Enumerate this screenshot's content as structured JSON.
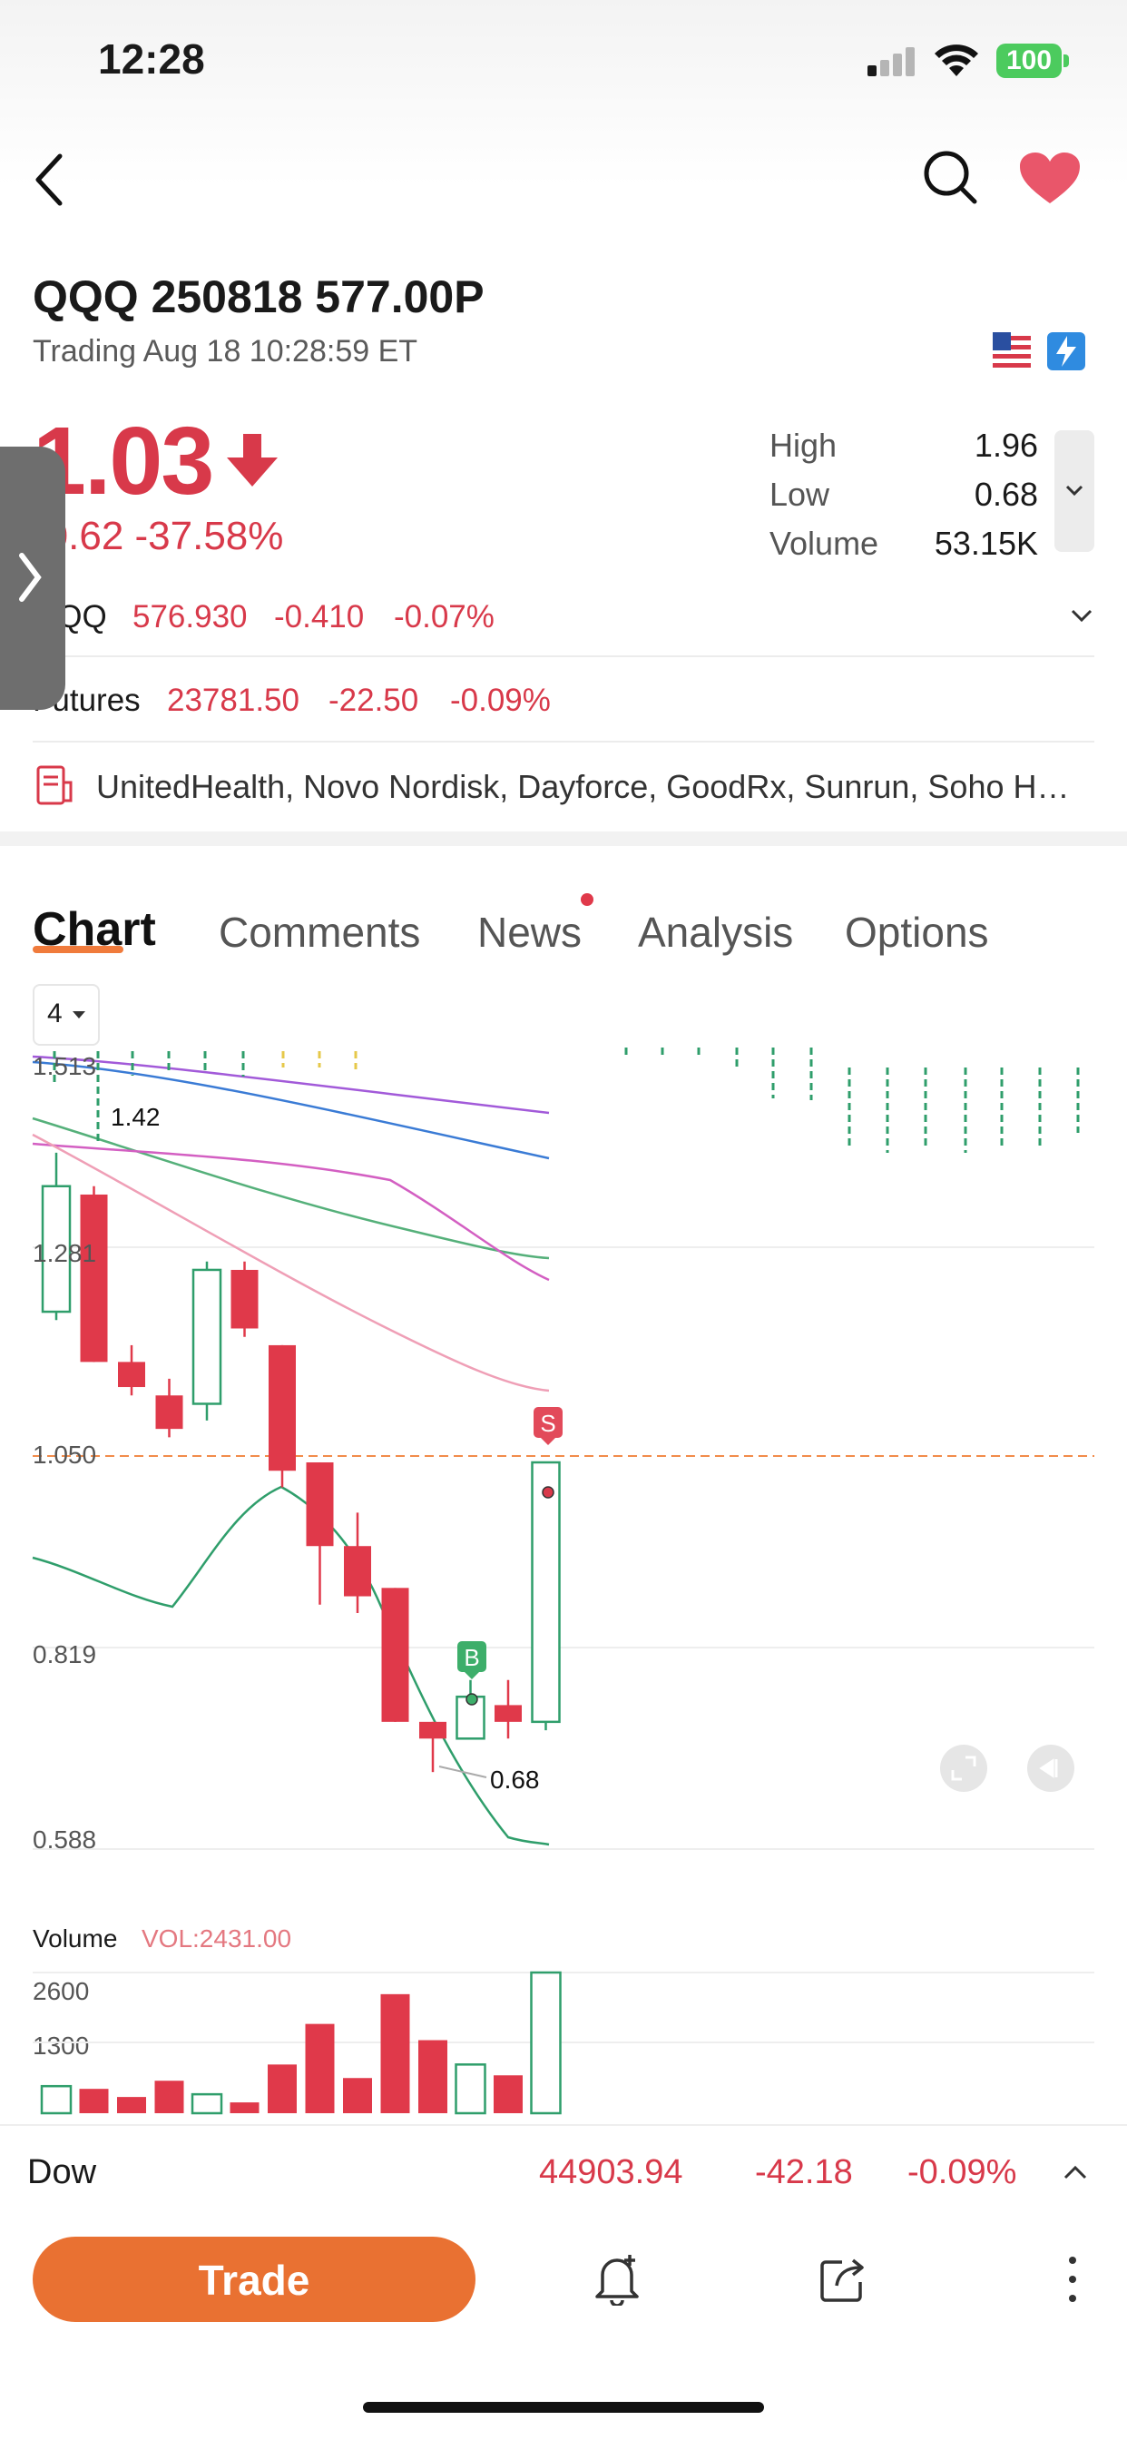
{
  "status_bar": {
    "time": "12:28",
    "battery": "100"
  },
  "header": {
    "back": "back",
    "search": "search",
    "favorite": "favorite"
  },
  "quote": {
    "symbol": "QQQ 250818 577.00P",
    "trading_status": "Trading Aug 18 10:28:59 ET",
    "price": "1.03",
    "change": "-0.62 -37.58%",
    "stats": [
      {
        "label": "High",
        "value": "1.96"
      },
      {
        "label": "Low",
        "value": "0.68"
      },
      {
        "label": "Volume",
        "value": "53.15K"
      }
    ]
  },
  "underlying": {
    "name": "QQQ",
    "price": "576.930",
    "change": "-0.410",
    "pct": "-0.07%"
  },
  "futures": {
    "name": "Futures",
    "price": "23781.50",
    "change": "-22.50",
    "pct": "-0.09%"
  },
  "news_ticker": "UnitedHealth, Novo Nordisk, Dayforce, GoodRx, Sunrun, Soho H…",
  "tabs": [
    "Chart",
    "Comments",
    "News",
    "Analysis",
    "Options"
  ],
  "chart": {
    "interval_label": "4",
    "y_ticks": [
      "1.513",
      "1.281",
      "1.050",
      "0.819",
      "0.588"
    ],
    "high_label": "1.42",
    "low_label": "0.68",
    "sell_marker": "S",
    "buy_marker": "B"
  },
  "chart_data": {
    "type": "candlestick",
    "ylim": [
      0.588,
      1.55
    ],
    "candles": [
      {
        "open": 1.23,
        "close": 1.38,
        "high": 1.42,
        "low": 1.22
      },
      {
        "open": 1.37,
        "close": 1.17,
        "high": 1.38,
        "low": 1.17
      },
      {
        "open": 1.17,
        "close": 1.14,
        "high": 1.19,
        "low": 1.13
      },
      {
        "open": 1.13,
        "close": 1.09,
        "high": 1.15,
        "low": 1.08
      },
      {
        "open": 1.12,
        "close": 1.28,
        "high": 1.29,
        "low": 1.1
      },
      {
        "open": 1.28,
        "close": 1.21,
        "high": 1.29,
        "low": 1.2
      },
      {
        "open": 1.19,
        "close": 1.04,
        "high": 1.19,
        "low": 1.02
      },
      {
        "open": 1.05,
        "close": 0.95,
        "high": 1.05,
        "low": 0.88
      },
      {
        "open": 0.95,
        "close": 0.89,
        "high": 0.99,
        "low": 0.87
      },
      {
        "open": 0.9,
        "close": 0.74,
        "high": 0.9,
        "low": 0.74
      },
      {
        "open": 0.74,
        "close": 0.72,
        "high": 0.74,
        "low": 0.68
      },
      {
        "open": 0.72,
        "close": 0.77,
        "high": 0.79,
        "low": 0.72
      },
      {
        "open": 0.76,
        "close": 0.74,
        "high": 0.79,
        "low": 0.72
      },
      {
        "open": 0.74,
        "close": 1.05,
        "high": 1.05,
        "low": 0.73
      }
    ],
    "volume": {
      "label": "Volume",
      "vol_text": "VOL:2431.00",
      "y_ticks": [
        "2600",
        "1300"
      ],
      "ylim": [
        0,
        2800
      ],
      "values": [
        500,
        450,
        300,
        600,
        350,
        200,
        900,
        1650,
        650,
        2200,
        1350,
        900,
        700,
        2600
      ],
      "up": [
        true,
        false,
        false,
        false,
        true,
        false,
        false,
        false,
        false,
        false,
        false,
        true,
        false,
        true
      ]
    }
  },
  "index_ticker": {
    "name": "Dow",
    "price": "44903.94",
    "change": "-42.18",
    "pct": "-0.09%"
  },
  "bottom": {
    "trade_label": "Trade"
  }
}
